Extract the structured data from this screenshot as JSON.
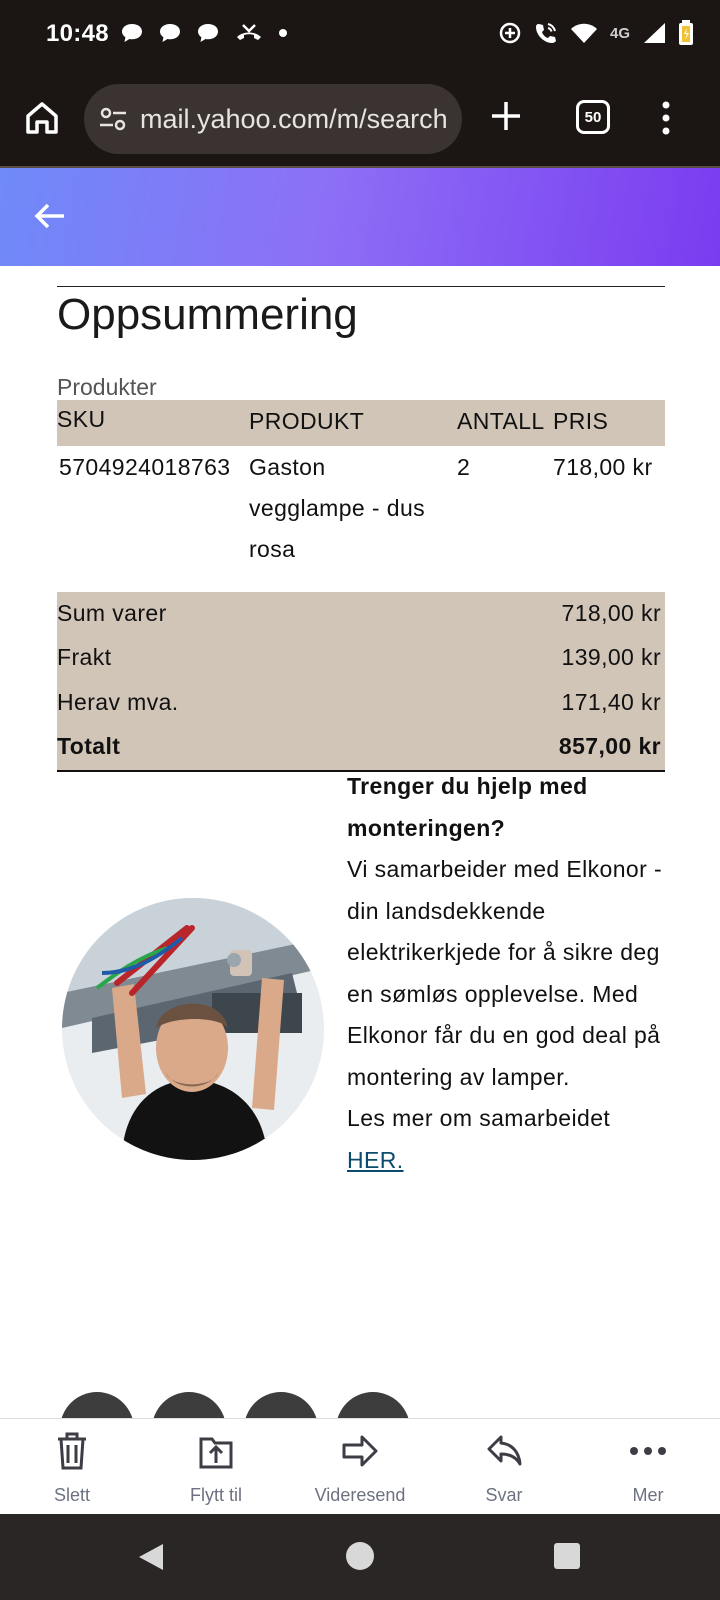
{
  "status_bar": {
    "time": "10:48",
    "network": "4G"
  },
  "browser": {
    "url": "mail.yahoo.com/m/search",
    "tab_count": "50"
  },
  "email": {
    "heading": "Oppsummering",
    "products_label": "Produkter",
    "table": {
      "headers": [
        "SKU",
        "PRODUKT",
        "ANTALL",
        "PRIS"
      ],
      "row": {
        "sku": "5704924018763",
        "product_lines": [
          "Gaston",
          "vegglampe - dus",
          "rosa"
        ],
        "quantity": "2",
        "price": "718,00 kr"
      }
    },
    "summary": [
      {
        "label": "Sum varer",
        "value": "718,00 kr"
      },
      {
        "label": "Frakt",
        "value": "139,00 kr"
      },
      {
        "label": "Herav mva.",
        "value": "171,40 kr"
      },
      {
        "label": "Totalt",
        "value": "857,00 kr"
      }
    ],
    "help": {
      "title": "Trenger du hjelp med monteringen?",
      "body": "Vi samarbeider med Elkonor - din landsdekkende elektrikerkjede for å sikre deg en sømløs opplevelse. Med Elkonor får du en god deal på montering av lamper.",
      "more_text": "Les mer om samarbeidet",
      "link_text": "HER."
    }
  },
  "actions": {
    "delete": "Slett",
    "move": "Flytt til",
    "forward": "Videresend",
    "reply": "Svar",
    "more": "Mer"
  },
  "colors": {
    "table_bg": "#d1c5b8",
    "link": "#0d4b6e",
    "header_gradient_start": "#6f8af9",
    "header_gradient_end": "#7a3cf0"
  }
}
